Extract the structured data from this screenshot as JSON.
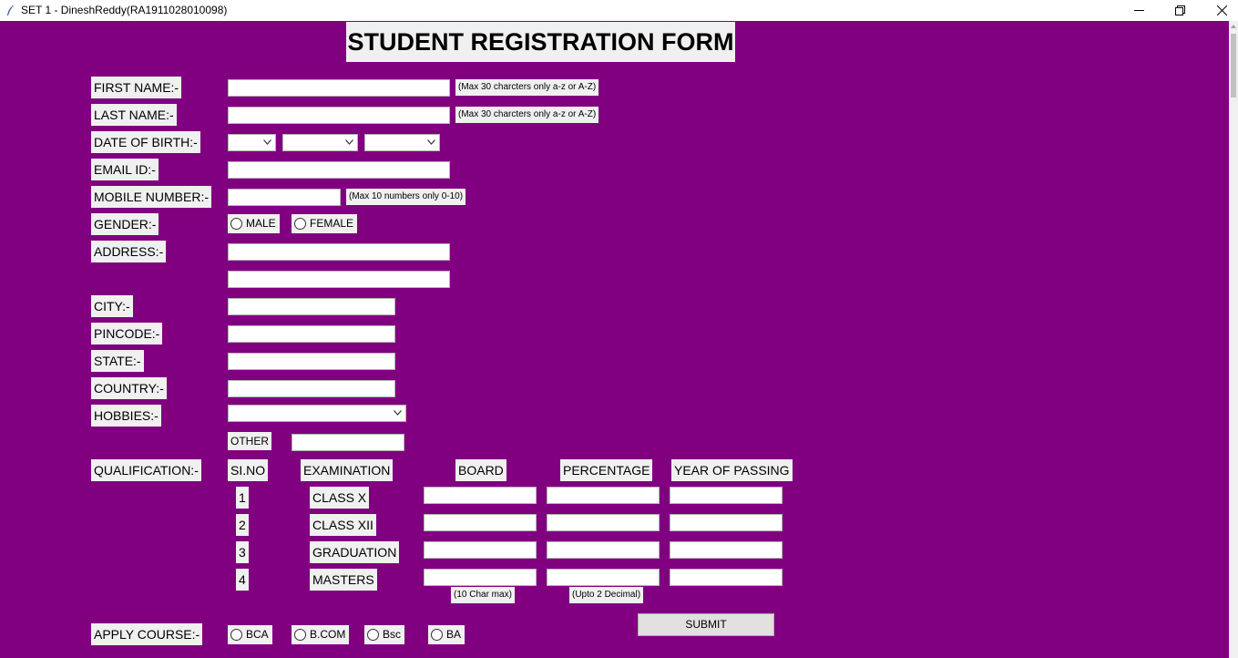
{
  "window": {
    "title": "SET 1 - DineshReddy(RA1911028010098)",
    "icons": [
      "feather-icon",
      "minimize-icon",
      "restore-icon",
      "close-icon"
    ]
  },
  "form": {
    "title": "STUDENT REGISTRATION FORM",
    "labels": {
      "first_name": "FIRST NAME:-",
      "last_name": "LAST NAME:-",
      "dob": "DATE OF BIRTH:-",
      "email": "EMAIL ID:-",
      "mobile": "MOBILE NUMBER:-",
      "gender": "GENDER:-",
      "address": "ADDRESS:-",
      "city": "CITY:-",
      "pincode": "PINCODE:-",
      "state": "STATE:-",
      "country": "COUNTRY:-",
      "hobbies": "HOBBIES:-",
      "other": "OTHER",
      "qualification": "QUALIFICATION:-",
      "apply_course": "APPLY COURSE:-"
    },
    "hints": {
      "first_name": "(Max 30 charcters only a-z or A-Z)",
      "last_name": "(Max 30 charcters only a-z or A-Z)",
      "mobile": "(Max 10 numbers only 0-10)",
      "board": "(10 Char max)",
      "percentage": "(Upto 2 Decimal)"
    },
    "gender_options": [
      "MALE",
      "FEMALE"
    ],
    "qualification": {
      "headers": [
        "SI.NO",
        "EXAMINATION",
        "BOARD",
        "PERCENTAGE",
        "YEAR OF PASSING"
      ],
      "rows": [
        {
          "sno": "1",
          "exam": "CLASS X"
        },
        {
          "sno": "2",
          "exam": "CLASS XII"
        },
        {
          "sno": "3",
          "exam": "GRADUATION"
        },
        {
          "sno": "4",
          "exam": "MASTERS"
        }
      ]
    },
    "courses": [
      "BCA",
      "B.COM",
      "Bsc",
      "BA"
    ],
    "submit_label": "SUBMIT"
  },
  "colors": {
    "background": "#800080",
    "label_bg": "#f0f0f0"
  }
}
